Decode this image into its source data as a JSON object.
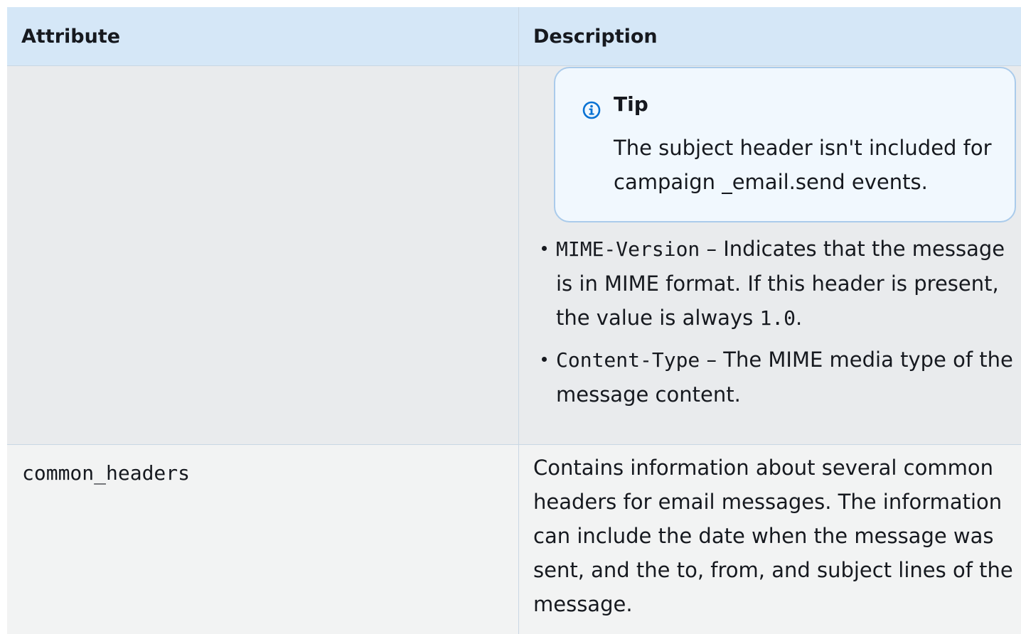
{
  "table": {
    "headers": {
      "attribute": "Attribute",
      "description": "Description"
    },
    "row1": {
      "tip": {
        "title": "Tip",
        "body": "The subject header isn't included for campaign _email.send events.",
        "icon": "info-circle-icon"
      },
      "bullets": [
        {
          "code": "MIME-Version",
          "text_before_value": " – Indicates that the message is in MIME format. If this header is present, the value is always ",
          "value_code": "1.0",
          "text_after": "."
        },
        {
          "code": "Content-Type",
          "text": " – The MIME media type of the message content."
        }
      ]
    },
    "row2": {
      "attribute": "common_headers",
      "description": "Contains information about several common headers for email messages. The information can include the date when the message was sent, and the to, from, and subject lines of the message."
    }
  },
  "colors": {
    "header_bg": "#d5e7f7",
    "row1_bg": "#e9ebed",
    "row2_bg": "#f2f3f3",
    "tip_bg": "#f1f8fe",
    "tip_border": "#aacbeb",
    "info_icon": "#0972d3"
  }
}
